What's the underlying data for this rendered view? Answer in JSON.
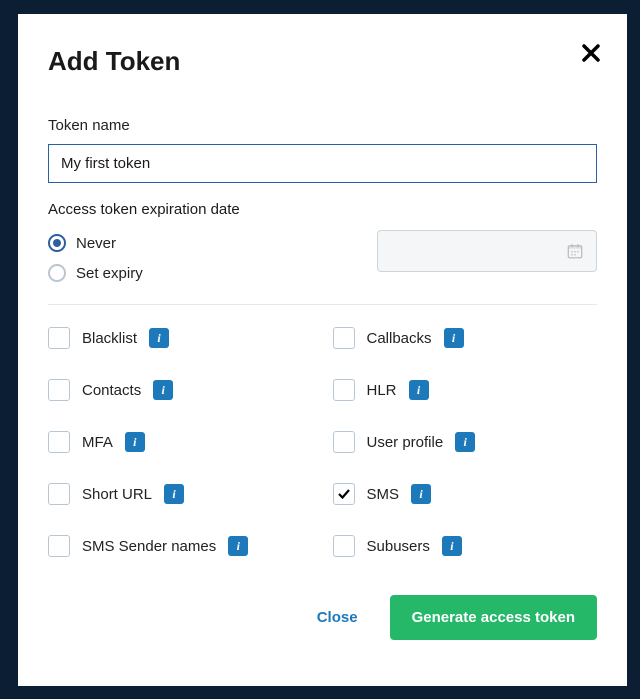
{
  "modal": {
    "title": "Add Token",
    "close_x_aria": "Close"
  },
  "tokenName": {
    "label": "Token name",
    "value": "My first token"
  },
  "expiration": {
    "label": "Access token expiration date",
    "options": {
      "never": {
        "label": "Never",
        "selected": true
      },
      "set": {
        "label": "Set expiry",
        "selected": false
      }
    },
    "date_value": "",
    "date_placeholder": ""
  },
  "permissions": [
    {
      "key": "blacklist",
      "label": "Blacklist",
      "checked": false,
      "info": true
    },
    {
      "key": "callbacks",
      "label": "Callbacks",
      "checked": false,
      "info": true
    },
    {
      "key": "contacts",
      "label": "Contacts",
      "checked": false,
      "info": true
    },
    {
      "key": "hlr",
      "label": "HLR",
      "checked": false,
      "info": true
    },
    {
      "key": "mfa",
      "label": "MFA",
      "checked": false,
      "info": true
    },
    {
      "key": "user_profile",
      "label": "User profile",
      "checked": false,
      "info": true
    },
    {
      "key": "short_url",
      "label": "Short URL",
      "checked": false,
      "info": true
    },
    {
      "key": "sms",
      "label": "SMS",
      "checked": true,
      "info": true
    },
    {
      "key": "sms_sender_names",
      "label": "SMS Sender names",
      "checked": false,
      "info": true
    },
    {
      "key": "subusers",
      "label": "Subusers",
      "checked": false,
      "info": true
    }
  ],
  "footer": {
    "close": "Close",
    "submit": "Generate access token"
  },
  "info_glyph": "i"
}
